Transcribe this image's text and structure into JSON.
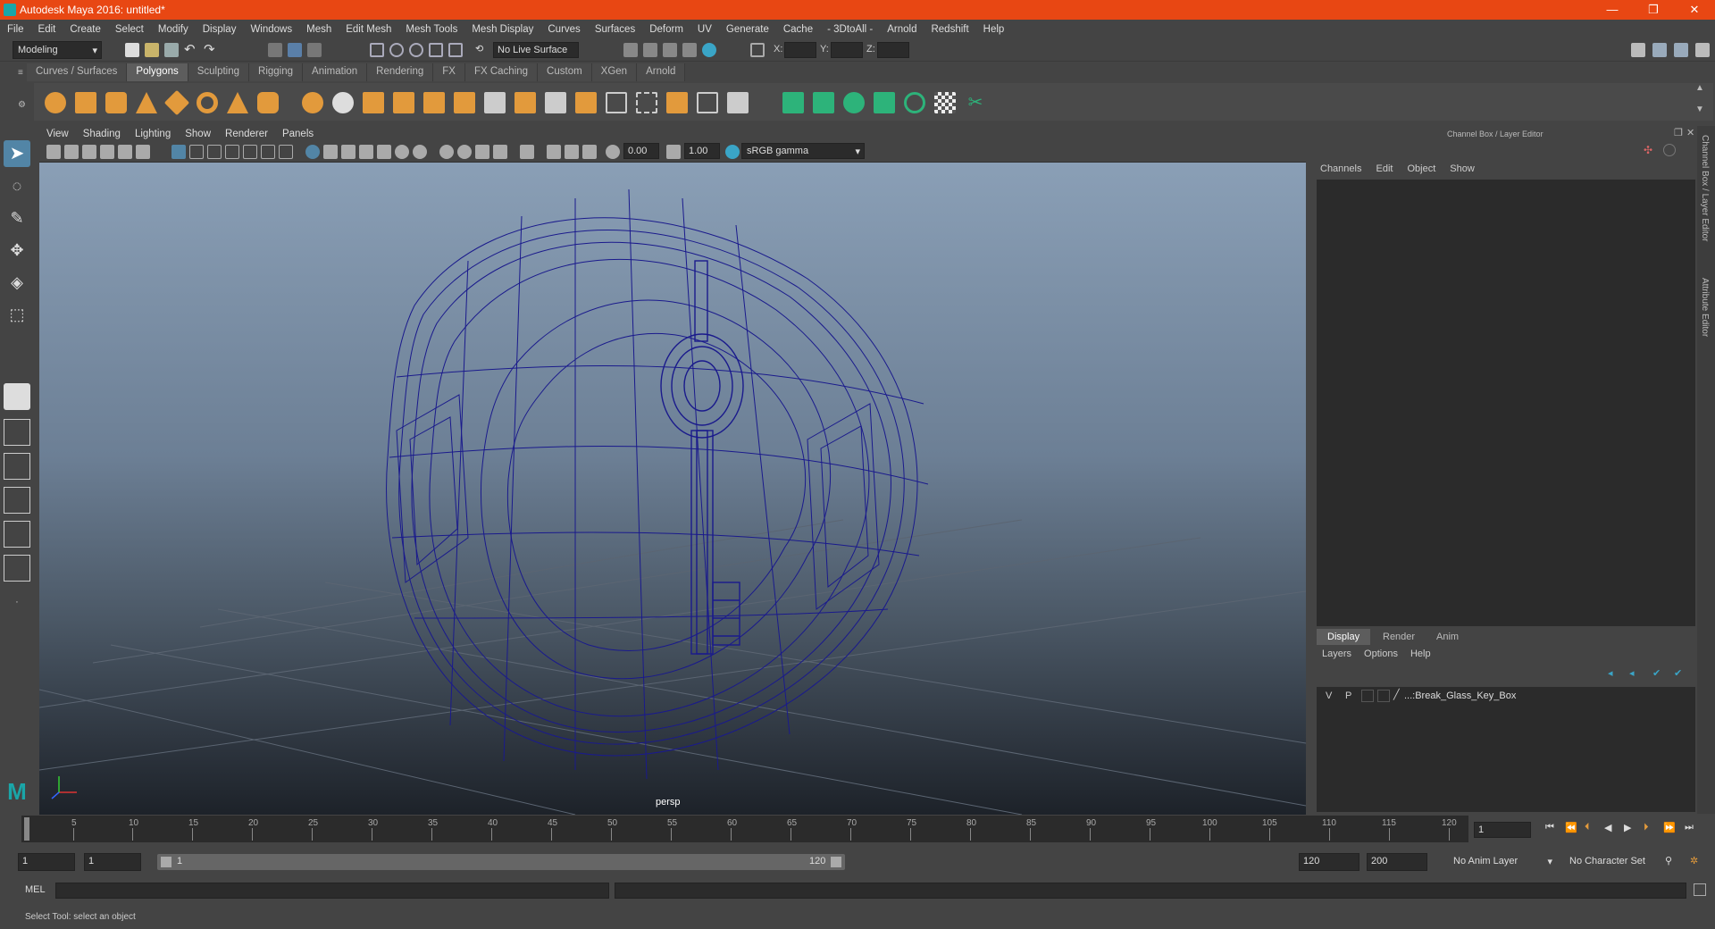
{
  "window": {
    "title": "Autodesk Maya 2016: untitled*",
    "minimize": "—",
    "restore": "❐",
    "close": "✕"
  },
  "menubar": [
    "File",
    "Edit",
    "Create",
    "Select",
    "Modify",
    "Display",
    "Windows",
    "Mesh",
    "Edit Mesh",
    "Mesh Tools",
    "Mesh Display",
    "Curves",
    "Surfaces",
    "Deform",
    "UV",
    "Generate",
    "Cache",
    "- 3DtoAll -",
    "Arnold",
    "Redshift",
    "Help"
  ],
  "statusline": {
    "mode": "Modeling",
    "live_surface": "No Live Surface",
    "x_label": "X:",
    "y_label": "Y:",
    "z_label": "Z:"
  },
  "shelf_tabs": [
    "Curves / Surfaces",
    "Polygons",
    "Sculpting",
    "Rigging",
    "Animation",
    "Rendering",
    "FX",
    "FX Caching",
    "Custom",
    "XGen",
    "Arnold"
  ],
  "shelf_active": "Polygons",
  "viewport": {
    "menus": [
      "View",
      "Shading",
      "Lighting",
      "Show",
      "Renderer",
      "Panels"
    ],
    "exposure": "0.00",
    "gamma": "1.00",
    "color_space": "sRGB gamma",
    "camera": "persp"
  },
  "right_panel": {
    "header": "Channel Box / Layer Editor",
    "channel_menus": [
      "Channels",
      "Edit",
      "Object",
      "Show"
    ],
    "layer_tabs": [
      "Display",
      "Render",
      "Anim"
    ],
    "layer_tab_active": "Display",
    "layer_menus": [
      "Layers",
      "Options",
      "Help"
    ],
    "layer": {
      "v": "V",
      "p": "P",
      "name": "...:Break_Glass_Key_Box"
    },
    "side_tabs": [
      "Channel Box / Layer Editor",
      "Attribute Editor"
    ]
  },
  "timeline": {
    "labels": [
      "5",
      "10",
      "15",
      "20",
      "25",
      "30",
      "35",
      "40",
      "45",
      "50",
      "55",
      "60",
      "65",
      "70",
      "75",
      "80",
      "85",
      "90",
      "95",
      "100",
      "105",
      "110",
      "115",
      "120"
    ],
    "current_frame": "1"
  },
  "range": {
    "start": "1",
    "playback_start": "1",
    "slider_start": "1",
    "slider_end": "120",
    "playback_end": "120",
    "end": "200",
    "anim_layer": "No Anim Layer",
    "character_set": "No Character Set"
  },
  "mel": {
    "label": "MEL"
  },
  "help_line": "Select Tool: select an object",
  "colors": {
    "title_bar": "#e84713",
    "wireframe": "#1a1a8c",
    "accent_active": "#5d5d5d"
  }
}
